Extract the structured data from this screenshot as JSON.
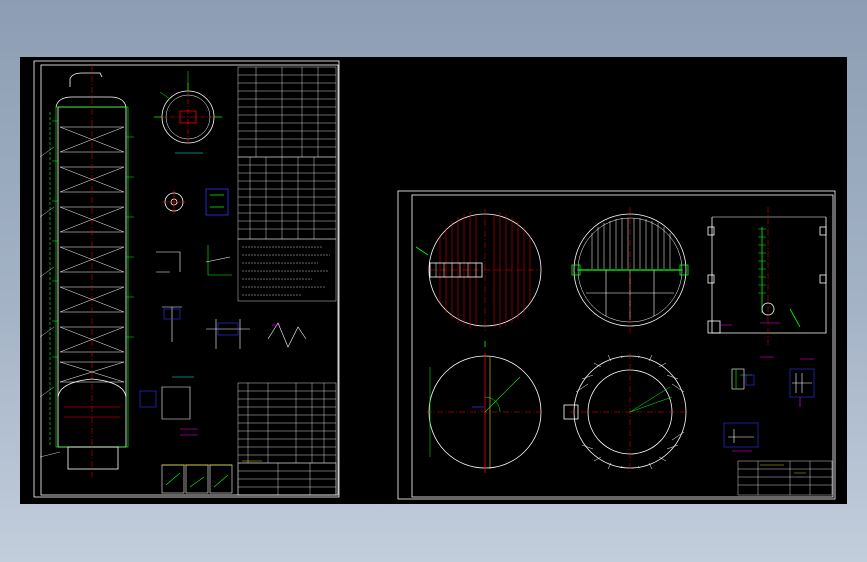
{
  "app": {
    "view": "cad-drawing-viewer"
  },
  "colors": {
    "background": "#000000",
    "frame": "#ffffff",
    "line_green": "#00ff00",
    "line_red": "#ff0000",
    "line_blue": "#3333ff",
    "line_yellow": "#ffff00",
    "line_magenta": "#ff00ff",
    "line_cyan": "#00ffff"
  },
  "sheets": [
    {
      "id": "sheet-1",
      "content": "column-assembly-drawing"
    },
    {
      "id": "sheet-2",
      "content": "tray-detail-drawing"
    }
  ]
}
